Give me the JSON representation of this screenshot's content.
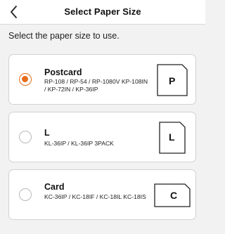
{
  "header": {
    "title": "Select Paper Size"
  },
  "instruction": "Select the paper size to use.",
  "accent_color": "#e76d1b",
  "paper_sizes": [
    {
      "name": "Postcard",
      "models": "RP-108 / RP-54 / RP-1080V KP-108IN / KP-72IN / KP-36IP",
      "icon_letter": "P",
      "selected": true
    },
    {
      "name": "L",
      "models": "KL-36IP / KL-36IP 3PACK",
      "icon_letter": "L",
      "selected": false
    },
    {
      "name": "Card",
      "models": "KC-36IP / KC-18IF / KC-18IL KC-18IS",
      "icon_letter": "C",
      "selected": false
    }
  ]
}
